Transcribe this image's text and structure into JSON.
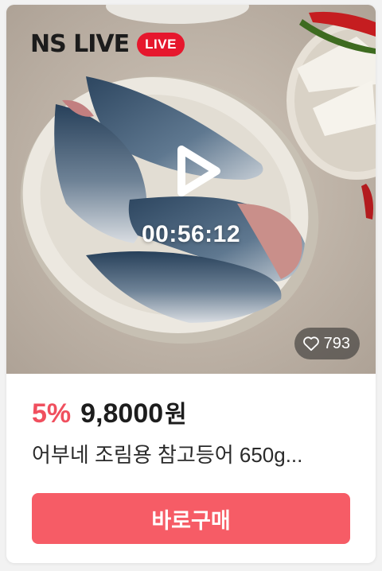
{
  "brand": {
    "logo": "NS LIVE",
    "badge": "LIVE"
  },
  "video": {
    "timer": "00:56:12",
    "play_icon": "play-icon"
  },
  "likes": {
    "count": "793",
    "icon": "heart-icon"
  },
  "product": {
    "discount": "5%",
    "price": "9,8000",
    "currency": "원",
    "title": "어부네 조림용 참고등어 650g..."
  },
  "cta": {
    "label": "바로구매"
  },
  "colors": {
    "live_badge": "#e6172d",
    "discount": "#f04f5e",
    "buy_button": "#f65c66"
  }
}
